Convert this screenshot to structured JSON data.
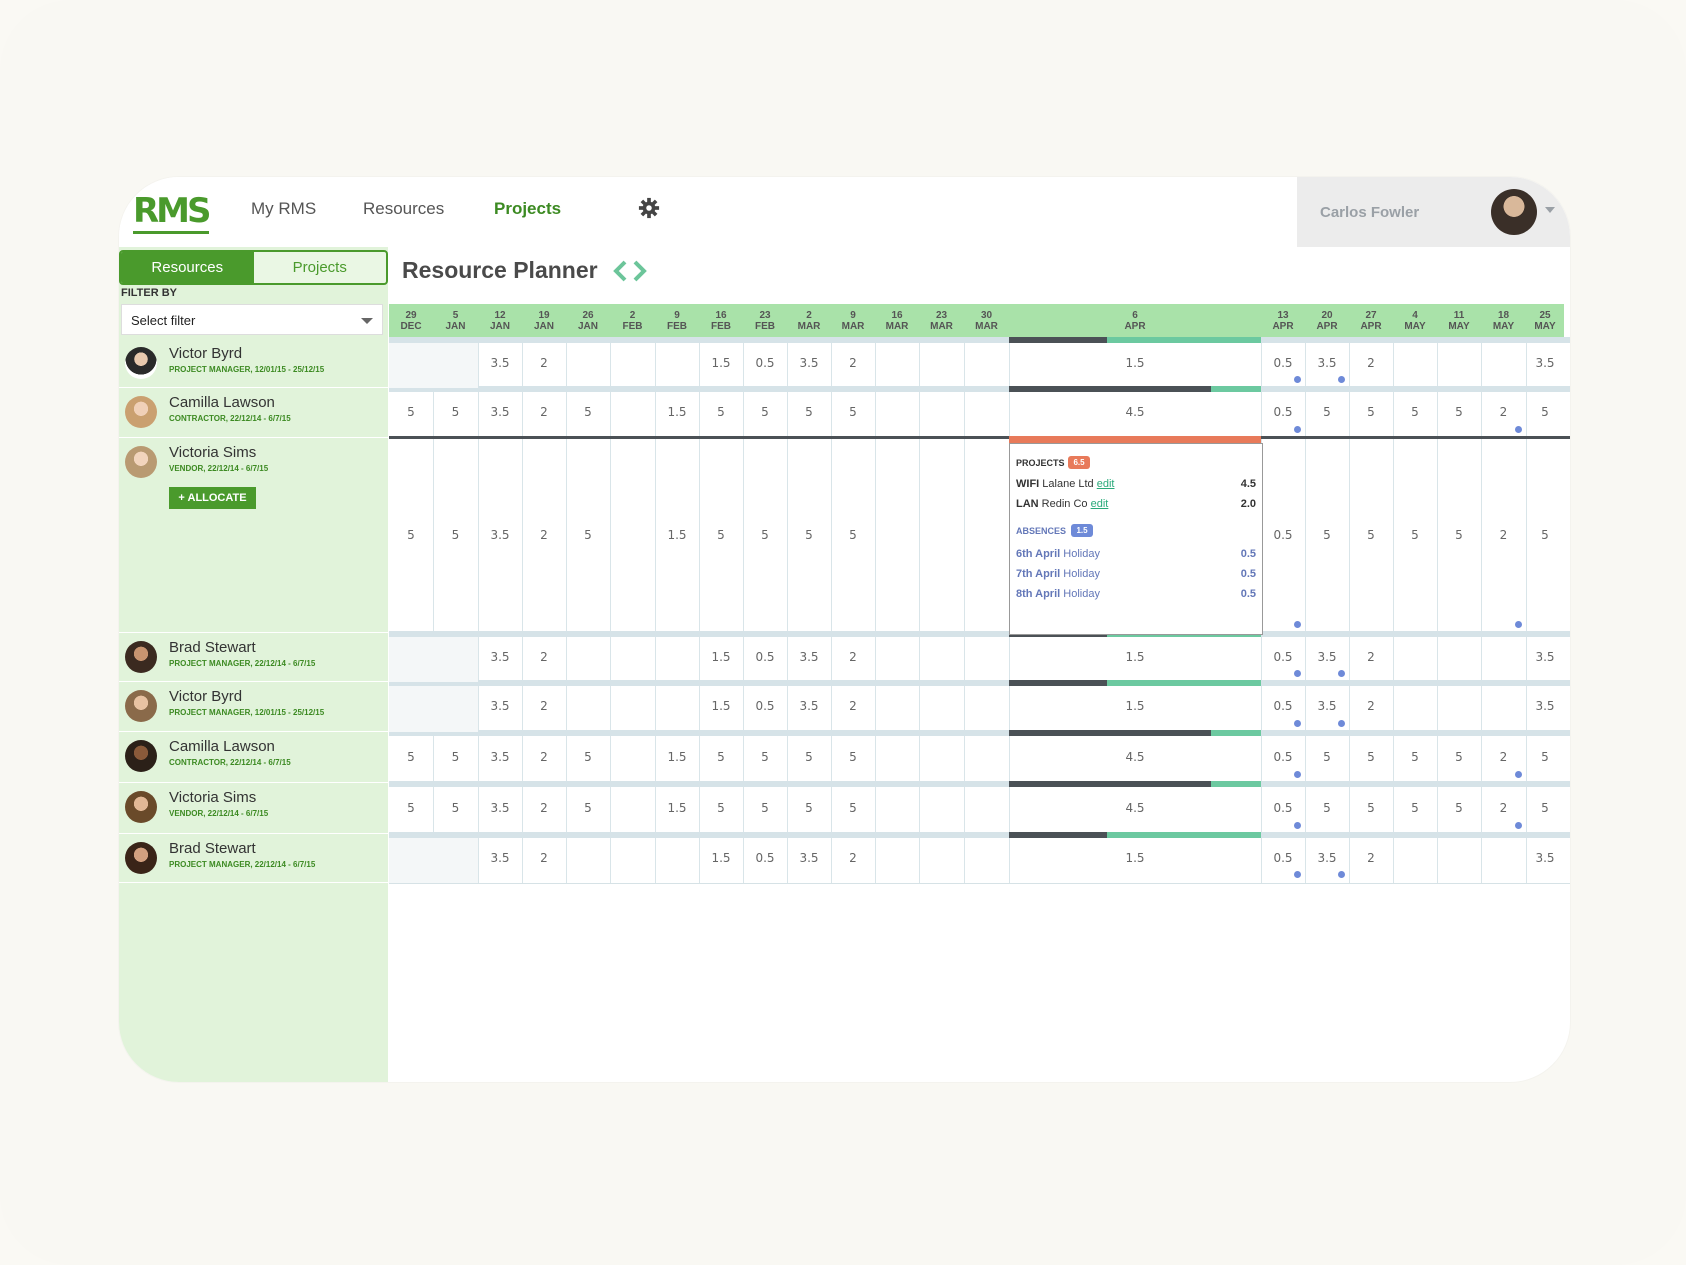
{
  "header": {
    "logo": "RMS",
    "nav": [
      "My RMS",
      "Resources",
      "Projects"
    ],
    "active_nav": "Projects",
    "user_name": "Carlos Fowler"
  },
  "sidebar": {
    "toggle": [
      "Resources",
      "Projects"
    ],
    "filter_label": "FILTER BY",
    "filter_placeholder": "Select filter",
    "allocate_label": "+ ALLOCATE",
    "resources": [
      {
        "name": "Victor Byrd",
        "sub": "PROJECT MANAGER, 12/01/15 - 25/12/15"
      },
      {
        "name": "Camilla Lawson",
        "sub": "CONTRACTOR, 22/12/14 - 6/7/15"
      },
      {
        "name": "Victoria Sims",
        "sub": "VENDOR, 22/12/14 - 6/7/15"
      },
      {
        "name": "Brad Stewart",
        "sub": "PROJECT MANAGER, 22/12/14 - 6/7/15"
      },
      {
        "name": "Victor Byrd",
        "sub": "PROJECT MANAGER, 12/01/15 - 25/12/15"
      },
      {
        "name": "Camilla Lawson",
        "sub": "CONTRACTOR, 22/12/14 - 6/7/15"
      },
      {
        "name": "Victoria Sims",
        "sub": "VENDOR, 22/12/14 - 6/7/15"
      },
      {
        "name": "Brad Stewart",
        "sub": "PROJECT MANAGER, 22/12/14 - 6/7/15"
      }
    ]
  },
  "planner": {
    "title": "Resource Planner",
    "columns": [
      {
        "d": "29",
        "m": "DEC"
      },
      {
        "d": "5",
        "m": "JAN"
      },
      {
        "d": "12",
        "m": "JAN"
      },
      {
        "d": "19",
        "m": "JAN"
      },
      {
        "d": "26",
        "m": "JAN"
      },
      {
        "d": "2",
        "m": "FEB"
      },
      {
        "d": "9",
        "m": "FEB"
      },
      {
        "d": "16",
        "m": "FEB"
      },
      {
        "d": "23",
        "m": "FEB"
      },
      {
        "d": "2",
        "m": "MAR"
      },
      {
        "d": "9",
        "m": "MAR"
      },
      {
        "d": "16",
        "m": "MAR"
      },
      {
        "d": "23",
        "m": "MAR"
      },
      {
        "d": "30",
        "m": "MAR"
      },
      {
        "d": "6",
        "m": "APR"
      },
      {
        "d": "13",
        "m": "APR"
      },
      {
        "d": "20",
        "m": "APR"
      },
      {
        "d": "27",
        "m": "APR"
      },
      {
        "d": "4",
        "m": "MAY"
      },
      {
        "d": "11",
        "m": "MAY"
      },
      {
        "d": "18",
        "m": "MAY"
      },
      {
        "d": "25",
        "m": "MAY"
      }
    ],
    "rows": [
      [
        "",
        "",
        "3.5",
        "2",
        "",
        "",
        "",
        "1.5",
        "0.5",
        "3.5",
        "2",
        "",
        "",
        "",
        "1.5",
        "0.5",
        "3.5",
        "2",
        "",
        "",
        "",
        "3.5"
      ],
      [
        "5",
        "5",
        "3.5",
        "2",
        "5",
        "",
        "1.5",
        "5",
        "5",
        "5",
        "5",
        "",
        "",
        "",
        "4.5",
        "0.5",
        "5",
        "5",
        "5",
        "5",
        "2",
        "5"
      ],
      [
        "5",
        "5",
        "3.5",
        "2",
        "5",
        "",
        "1.5",
        "5",
        "5",
        "5",
        "5",
        "",
        "",
        "",
        "",
        "0.5",
        "5",
        "5",
        "5",
        "5",
        "2",
        "5"
      ],
      [
        "",
        "",
        "3.5",
        "2",
        "",
        "",
        "",
        "1.5",
        "0.5",
        "3.5",
        "2",
        "",
        "",
        "",
        "1.5",
        "0.5",
        "3.5",
        "2",
        "",
        "",
        "",
        "3.5"
      ],
      [
        "",
        "",
        "3.5",
        "2",
        "",
        "",
        "",
        "1.5",
        "0.5",
        "3.5",
        "2",
        "",
        "",
        "",
        "1.5",
        "0.5",
        "3.5",
        "2",
        "",
        "",
        "",
        "3.5"
      ],
      [
        "5",
        "5",
        "3.5",
        "2",
        "5",
        "",
        "1.5",
        "5",
        "5",
        "5",
        "5",
        "",
        "",
        "",
        "4.5",
        "0.5",
        "5",
        "5",
        "5",
        "5",
        "2",
        "5"
      ],
      [
        "5",
        "5",
        "3.5",
        "2",
        "5",
        "",
        "1.5",
        "5",
        "5",
        "5",
        "5",
        "",
        "",
        "",
        "4.5",
        "0.5",
        "5",
        "5",
        "5",
        "5",
        "2",
        "5"
      ],
      [
        "",
        "",
        "3.5",
        "2",
        "",
        "",
        "",
        "1.5",
        "0.5",
        "3.5",
        "2",
        "",
        "",
        "",
        "1.5",
        "0.5",
        "3.5",
        "2",
        "",
        "",
        "",
        "3.5"
      ]
    ],
    "popup": {
      "projects_label": "PROJECTS",
      "projects_total": "6.5",
      "projects": [
        {
          "code": "WIFI",
          "client": "Lalane Ltd",
          "edit": "edit",
          "value": "4.5"
        },
        {
          "code": "LAN",
          "client": "Redin Co",
          "edit": "edit",
          "value": "2.0"
        }
      ],
      "absences_label": "ABSENCES",
      "absences_total": "1.5",
      "absences": [
        {
          "date": "6th April",
          "type": "Holiday",
          "value": "0.5"
        },
        {
          "date": "7th April",
          "type": "Holiday",
          "value": "0.5"
        },
        {
          "date": "8th April",
          "type": "Holiday",
          "value": "0.5"
        }
      ]
    }
  },
  "colors": {
    "brand": "#4a9a2c",
    "header_band": "#a9e2a9",
    "sidebar": "#e1f3da",
    "popup_accent": "#e87a5a",
    "absence": "#6e8ad8"
  }
}
